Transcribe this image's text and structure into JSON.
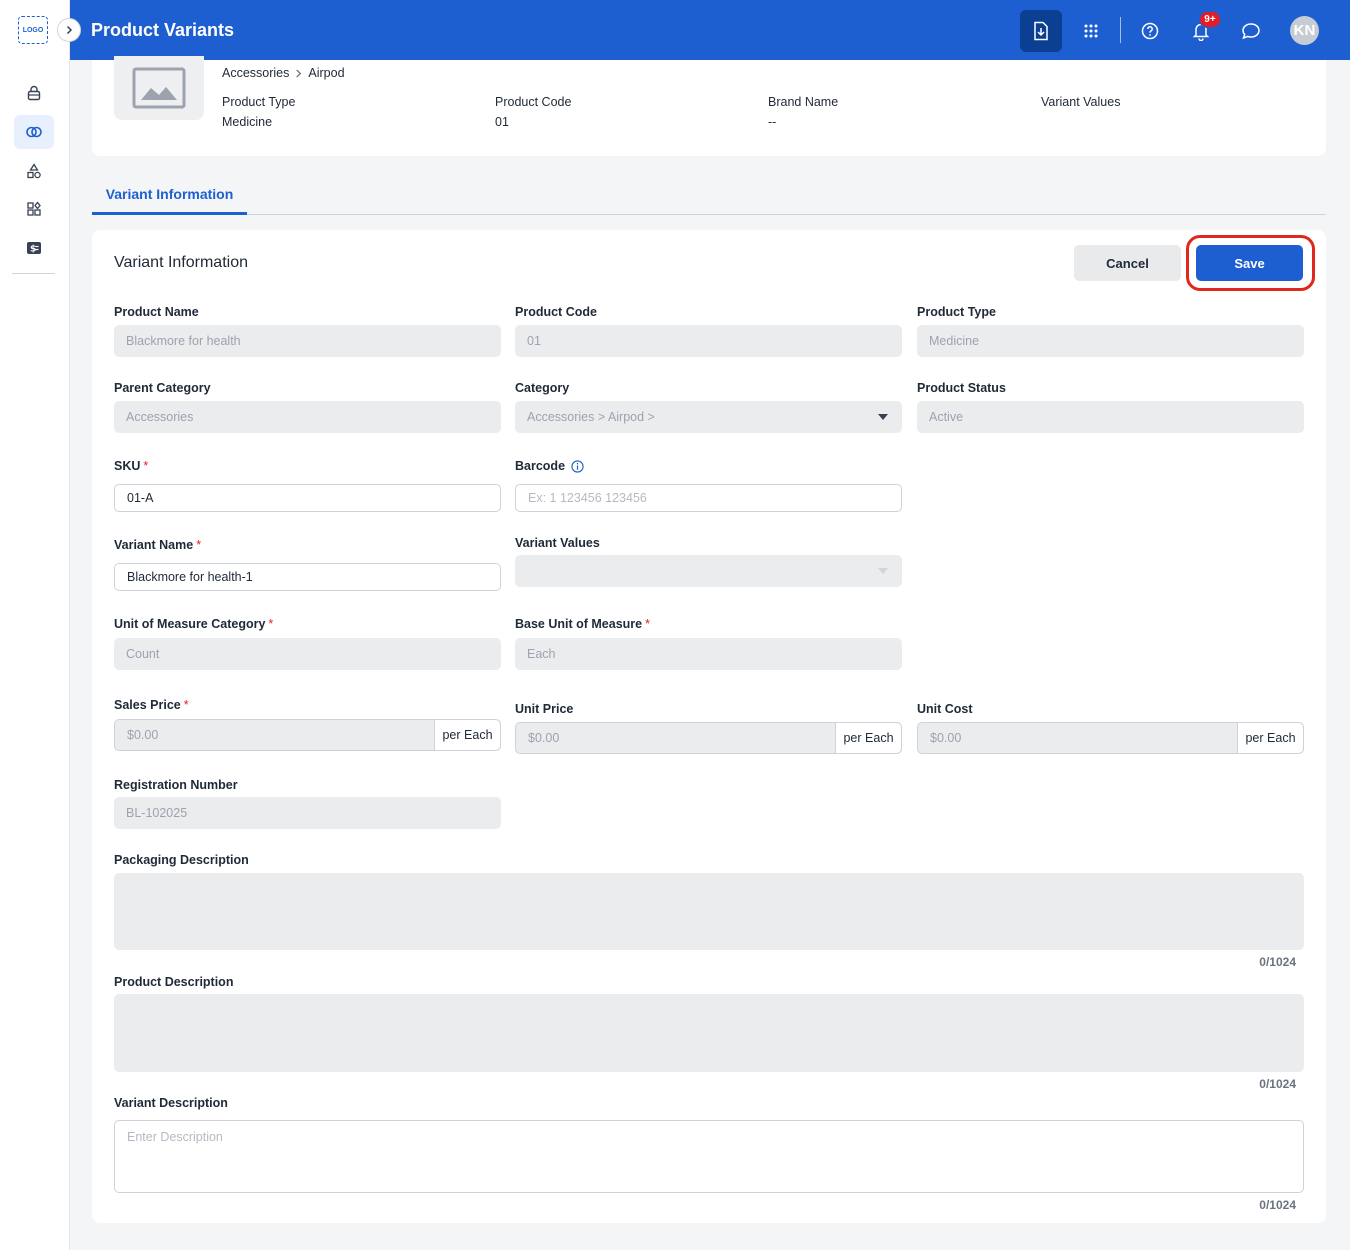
{
  "app": {
    "logo_text": "LOGO",
    "title": "Product Variants",
    "avatar_initials": "KN",
    "notification_count": "9+"
  },
  "summary": {
    "breadcrumb": [
      "Accessories",
      "Airpod"
    ],
    "fields": [
      {
        "label": "Product Type",
        "value": "Medicine"
      },
      {
        "label": "Product Code",
        "value": "01"
      },
      {
        "label": "Brand Name",
        "value": "--"
      },
      {
        "label": "Variant Values",
        "value": ""
      }
    ]
  },
  "tabs": [
    "Variant Information"
  ],
  "form": {
    "heading": "Variant Information",
    "cancel_label": "Cancel",
    "save_label": "Save",
    "product_name": {
      "label": "Product Name",
      "value": "Blackmore for health"
    },
    "product_code": {
      "label": "Product Code",
      "value": "01"
    },
    "product_type": {
      "label": "Product Type",
      "value": "Medicine"
    },
    "parent_category": {
      "label": "Parent Category",
      "value": "Accessories"
    },
    "category": {
      "label": "Category",
      "value": "Accessories > Airpod >"
    },
    "product_status": {
      "label": "Product Status",
      "value": "Active"
    },
    "sku": {
      "label": "SKU",
      "value": "01-A"
    },
    "barcode": {
      "label": "Barcode",
      "placeholder": "Ex: 1 123456 123456"
    },
    "variant_name": {
      "label": "Variant Name",
      "value": "Blackmore for health-1"
    },
    "variant_values": {
      "label": "Variant Values",
      "value": ""
    },
    "uom_category": {
      "label": "Unit of Measure Category",
      "value": "Count"
    },
    "base_uom": {
      "label": "Base Unit of Measure",
      "value": "Each"
    },
    "sales_price": {
      "label": "Sales Price",
      "value": "$0.00",
      "suffix": "per Each"
    },
    "unit_price": {
      "label": "Unit Price",
      "value": "$0.00",
      "suffix": "per Each"
    },
    "unit_cost": {
      "label": "Unit Cost",
      "value": "$0.00",
      "suffix": "per Each"
    },
    "registration_number": {
      "label": "Registration Number",
      "value": "BL-102025"
    },
    "packaging_description": {
      "label": "Packaging Description",
      "counter": "0/1024"
    },
    "product_description": {
      "label": "Product Description",
      "counter": "0/1024"
    },
    "variant_description": {
      "label": "Variant Description",
      "placeholder": "Enter Description",
      "counter": "0/1024"
    },
    "required_marker": "*"
  },
  "colors": {
    "primary": "#1d5fd0",
    "highlight_ring": "#e0271b",
    "badge": "#e11d2a"
  }
}
